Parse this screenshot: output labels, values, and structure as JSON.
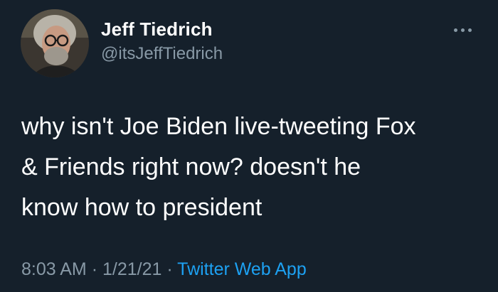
{
  "tweet": {
    "display_name": "Jeff Tiedrich",
    "handle": "@itsJeffTiedrich",
    "text_lines": [
      "why isn't Joe Biden live-tweeting Fox",
      "& Friends right now? doesn't he",
      "know how to president"
    ],
    "time": "8:03 AM",
    "separator": "·",
    "date": "1/21/21",
    "source": "Twitter Web App"
  },
  "colors": {
    "background": "#15202b",
    "secondary_text": "#8899a6",
    "link": "#1da1f2"
  },
  "icons": {
    "more": "more-horizontal-icon"
  }
}
